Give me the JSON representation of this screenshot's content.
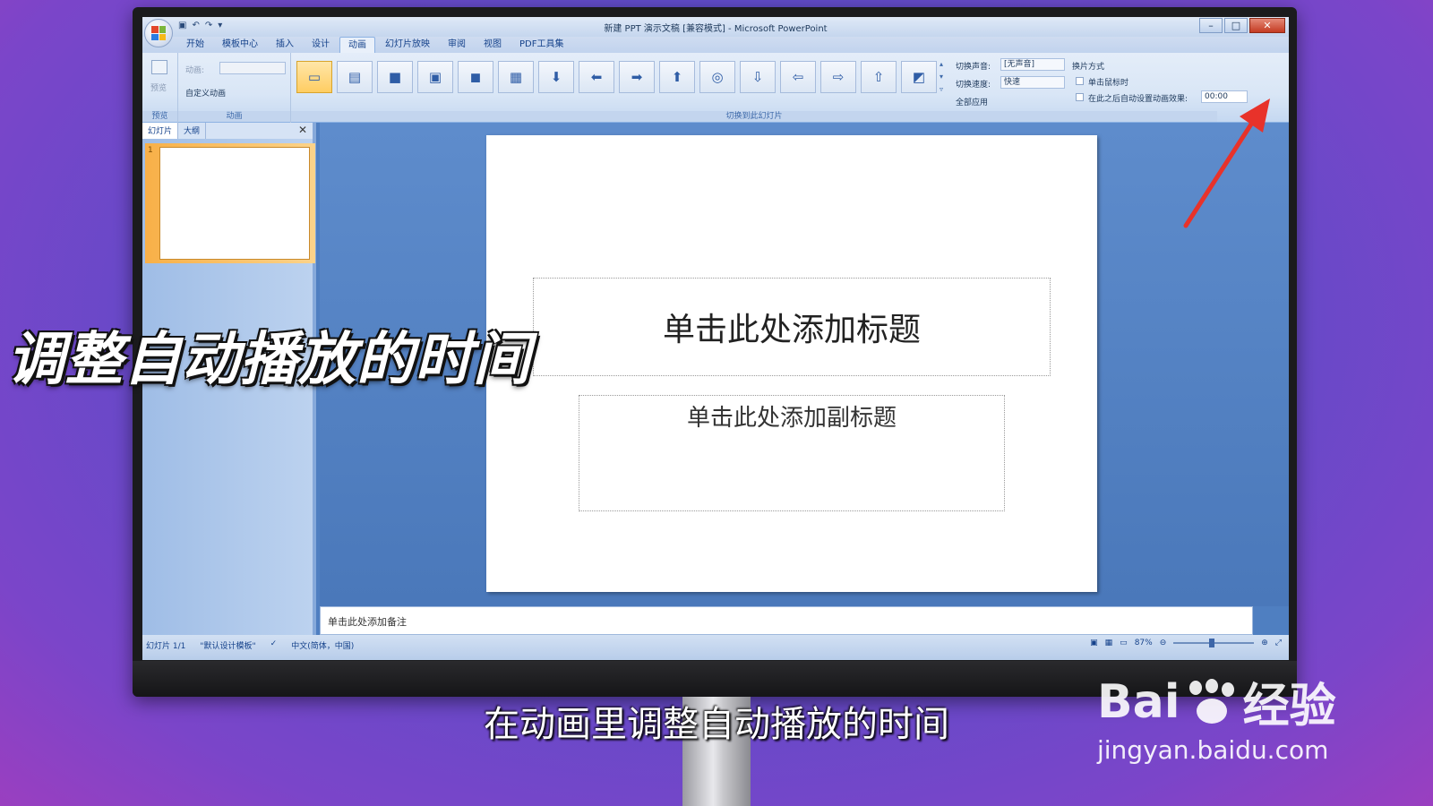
{
  "window": {
    "title": "新建 PPT 演示文稿 [兼容模式] - Microsoft PowerPoint",
    "qat_icons": [
      "save-icon",
      "undo-icon",
      "redo-icon"
    ]
  },
  "tabs": [
    {
      "label": "开始"
    },
    {
      "label": "模板中心"
    },
    {
      "label": "插入"
    },
    {
      "label": "设计"
    },
    {
      "label": "动画",
      "active": true
    },
    {
      "label": "幻灯片放映"
    },
    {
      "label": "审阅"
    },
    {
      "label": "视图"
    },
    {
      "label": "PDF工具集"
    }
  ],
  "ribbon": {
    "preview": {
      "button": "预览",
      "group": "预览"
    },
    "animation": {
      "anim_label": "动画:",
      "custom": "自定义动画",
      "group": "动画"
    },
    "transition": {
      "group": "切换到此幻灯片",
      "sound_label": "切换声音:",
      "sound_value": "[无声音]",
      "speed_label": "切换速度:",
      "speed_value": "快速",
      "apply_all": "全部应用"
    },
    "advance": {
      "heading": "换片方式",
      "on_click": "单击鼠标时",
      "auto_after": "在此之后自动设置动画效果:",
      "time_value": "00:00"
    }
  },
  "left_pane": {
    "tab_slides": "幻灯片",
    "tab_outline": "大纲",
    "slide_number": "1"
  },
  "slide": {
    "title_placeholder": "单击此处添加标题",
    "subtitle_placeholder": "单击此处添加副标题"
  },
  "notes": {
    "placeholder": "单击此处添加备注"
  },
  "status": {
    "slide_count": "幻灯片 1/1",
    "template": "\"默认设计模板\"",
    "language": "中文(简体，中国)",
    "zoom": "87%"
  },
  "overlay": {
    "heading": "调整自动播放的时间",
    "subtitle": "在动画里调整自动播放的时间",
    "watermark_logo_a": "Bai",
    "watermark_logo_b": "经验",
    "watermark_url": "jingyan.baidu.com"
  },
  "colors": {
    "accent_arrow": "#e8322a",
    "ribbon_active_thumb": "#ffcd62"
  }
}
